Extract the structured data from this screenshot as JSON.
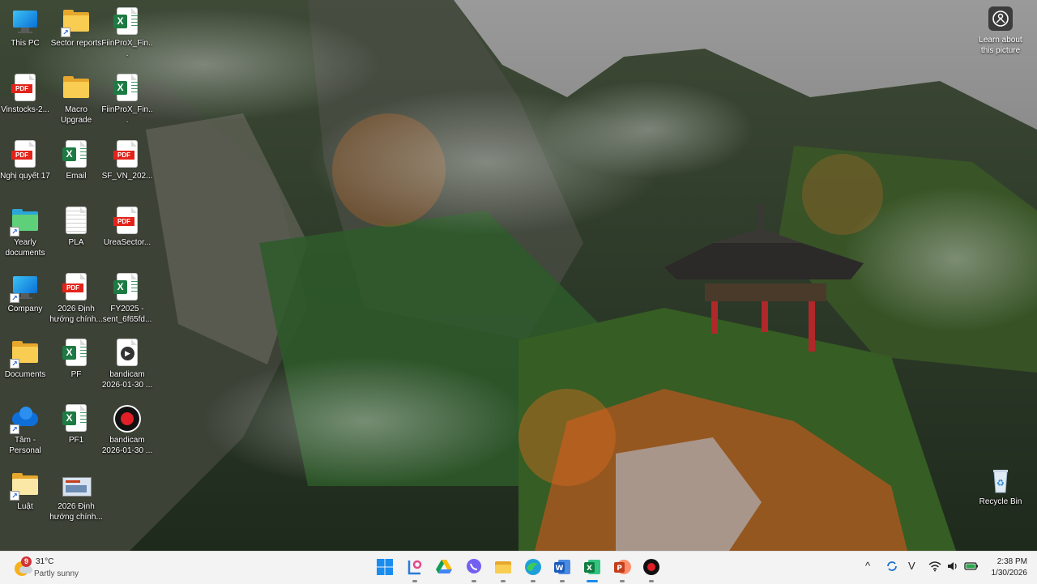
{
  "desktop": {
    "icons": [
      {
        "label": "This PC",
        "type": "monitor",
        "icon": "computer-icon"
      },
      {
        "label": "Sector reports",
        "type": "folder-shortcut",
        "icon": "folder-icon"
      },
      {
        "label": "FiinProX_Fin...",
        "type": "excel",
        "icon": "excel-file-icon"
      },
      {
        "label": "Vinstocks-2...",
        "type": "pdf",
        "icon": "pdf-file-icon"
      },
      {
        "label": "Macro Upgrade",
        "type": "folder",
        "icon": "folder-icon"
      },
      {
        "label": "FiinProX_Fin...",
        "type": "excel",
        "icon": "excel-file-icon"
      },
      {
        "label": "Nghị quyết 17",
        "type": "pdf",
        "icon": "pdf-file-icon"
      },
      {
        "label": "Email",
        "type": "excel",
        "icon": "excel-file-icon"
      },
      {
        "label": "SF_VN_202...",
        "type": "pdf",
        "icon": "pdf-file-icon"
      },
      {
        "label": "Yearly documents",
        "type": "folder-shortcut",
        "icon": "folder-icon"
      },
      {
        "label": "PLA",
        "type": "text",
        "icon": "text-file-icon"
      },
      {
        "label": "UreaSector...",
        "type": "pdf",
        "icon": "pdf-file-icon"
      },
      {
        "label": "Company",
        "type": "monitor-shortcut",
        "icon": "network-icon"
      },
      {
        "label": "2026 Định hướng chính...",
        "type": "pdf",
        "icon": "pdf-file-icon"
      },
      {
        "label": "FY2025 - sent_6f65fd...",
        "type": "excel",
        "icon": "excel-file-icon"
      },
      {
        "label": "Documents",
        "type": "folder-shortcut",
        "icon": "folder-icon"
      },
      {
        "label": "PF",
        "type": "excel",
        "icon": "excel-file-icon"
      },
      {
        "label": "bandicam 2026-01-30 ...",
        "type": "media",
        "icon": "video-file-icon"
      },
      {
        "label": "Tâm - Personal",
        "type": "onedrive",
        "icon": "onedrive-icon"
      },
      {
        "label": "PF1",
        "type": "excel",
        "icon": "excel-file-icon"
      },
      {
        "label": "bandicam 2026-01-30 ...",
        "type": "bandicam",
        "icon": "bandicam-icon"
      },
      {
        "label": "Luật",
        "type": "folder-shortcut",
        "icon": "folder-icon"
      },
      {
        "label": "2026 Định hướng chính...",
        "type": "ppt",
        "icon": "powerpoint-file-icon"
      },
      {
        "label": "Recycle Bin",
        "type": "recycle",
        "icon": "recycle-bin-icon"
      }
    ],
    "learn_label": "Learn about this picture"
  },
  "taskbar": {
    "weather": {
      "badge": "9",
      "temp": "31°C",
      "condition": "Partly sunny"
    },
    "apps": [
      "start-icon",
      "snipping-tool-icon",
      "google-drive-icon",
      "viber-icon",
      "file-explorer-icon",
      "edge-icon",
      "word-icon",
      "excel-icon",
      "powerpoint-icon",
      "record-icon"
    ],
    "tray": {
      "chevron": "^",
      "vpn": "V"
    },
    "clock": {
      "time": "2:38 PM",
      "date": "1/30/2026"
    }
  },
  "colors": {
    "pdf": "#e2231a",
    "excel": "#1d7a43",
    "folder": "#f8cd52",
    "taskbar": "#f3f3f3"
  }
}
